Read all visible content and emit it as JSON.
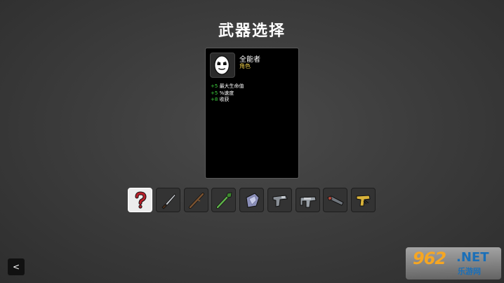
{
  "screen_title": "武器选择",
  "character": {
    "name": "全能者",
    "type": "角色",
    "stats": [
      {
        "value": "+5",
        "label": "最大生命值"
      },
      {
        "value": "+5",
        "label": "%速度"
      },
      {
        "value": "+8",
        "label": "收获"
      }
    ]
  },
  "weapons": [
    {
      "icon": "random-question-icon",
      "selected": true
    },
    {
      "icon": "knife-icon",
      "selected": false
    },
    {
      "icon": "stick-icon",
      "selected": false
    },
    {
      "icon": "spear-icon",
      "selected": false
    },
    {
      "icon": "crystal-icon",
      "selected": false
    },
    {
      "icon": "pistol-icon",
      "selected": false
    },
    {
      "icon": "smg-icon",
      "selected": false
    },
    {
      "icon": "shotgun-icon",
      "selected": false
    },
    {
      "icon": "taser-icon",
      "selected": false
    }
  ],
  "back_button": {
    "label": "<"
  },
  "watermark": {
    "number": "962",
    "suffix": ".NET",
    "subtitle": "乐游网"
  },
  "colors": {
    "stat_value": "#3fd43f",
    "char_type": "#f2d24a",
    "selected_slot": "#ececec"
  }
}
